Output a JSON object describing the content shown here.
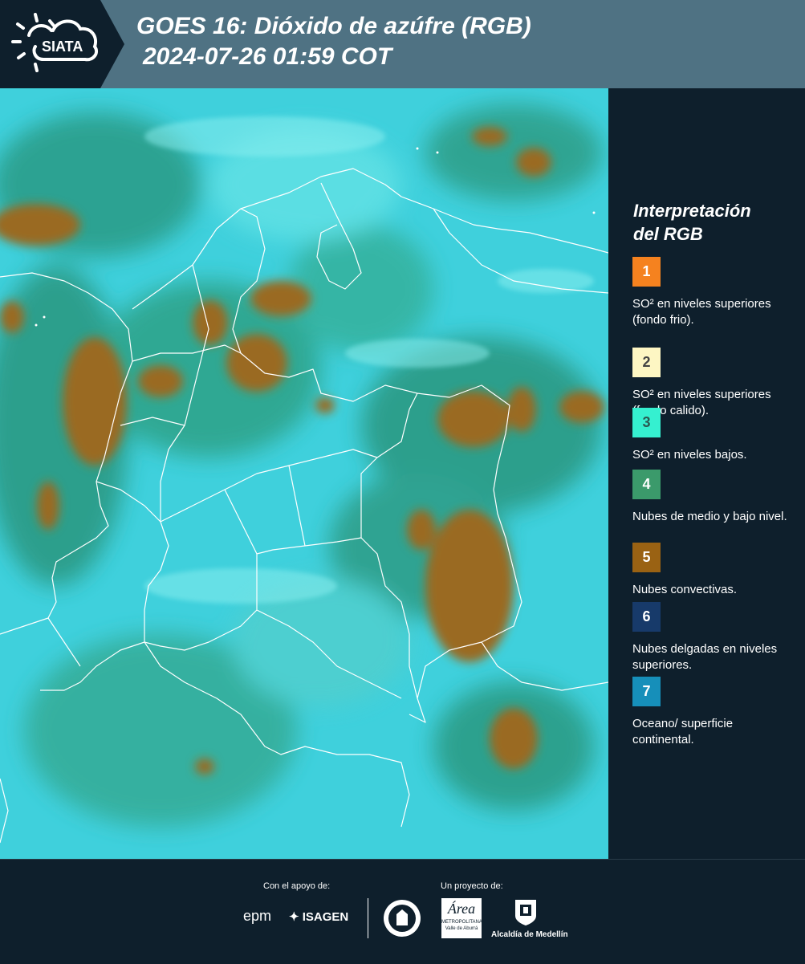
{
  "header": {
    "logo_text": "SIATA",
    "title_line1": "GOES 16: Dióxido de azúfre (RGB)",
    "title_line2": "2024-07-26 01:59 COT"
  },
  "legend": {
    "title_line1": "Interpretación",
    "title_line2": "del RGB",
    "items": [
      {
        "num": "1",
        "color": "#f5821f",
        "num_color": "#ffffff",
        "text": "SO² en niveles superiores (fondo frio)."
      },
      {
        "num": "2",
        "color": "#fdf6c3",
        "num_color": "#444444",
        "text": "SO² en niveles superiores (fondo calido)."
      },
      {
        "num": "3",
        "color": "#35f0d0",
        "num_color": "#2a5a52",
        "text": "SO² en niveles bajos."
      },
      {
        "num": "4",
        "color": "#3b9a6b",
        "num_color": "#ffffff",
        "text": "Nubes de medio y bajo nivel."
      },
      {
        "num": "5",
        "color": "#9a6213",
        "num_color": "#ffffff",
        "text": "Nubes convectivas."
      },
      {
        "num": "6",
        "color": "#173a6a",
        "num_color": "#ffffff",
        "text": "Nubes delgadas en niveles superiores."
      },
      {
        "num": "7",
        "color": "#168fba",
        "num_color": "#ffffff",
        "text": "Oceano/ superficie continental."
      }
    ]
  },
  "footer": {
    "support_label": "Con el apoyo de:",
    "project_label": "Un proyecto de:",
    "sponsor_epm": "epm",
    "sponsor_isagen": "ISAGEN",
    "area_logo_text": "Área",
    "area_subtitle": "METROPOLITANA",
    "area_subtitle2": "Valle de Aburrá",
    "alcaldia_text": "Alcaldía de Medellín"
  },
  "colors": {
    "background": "#0e1f2c",
    "header": "#4f7283",
    "cyan_surface": "#3fd3e0",
    "convective": "#9a6a22"
  }
}
